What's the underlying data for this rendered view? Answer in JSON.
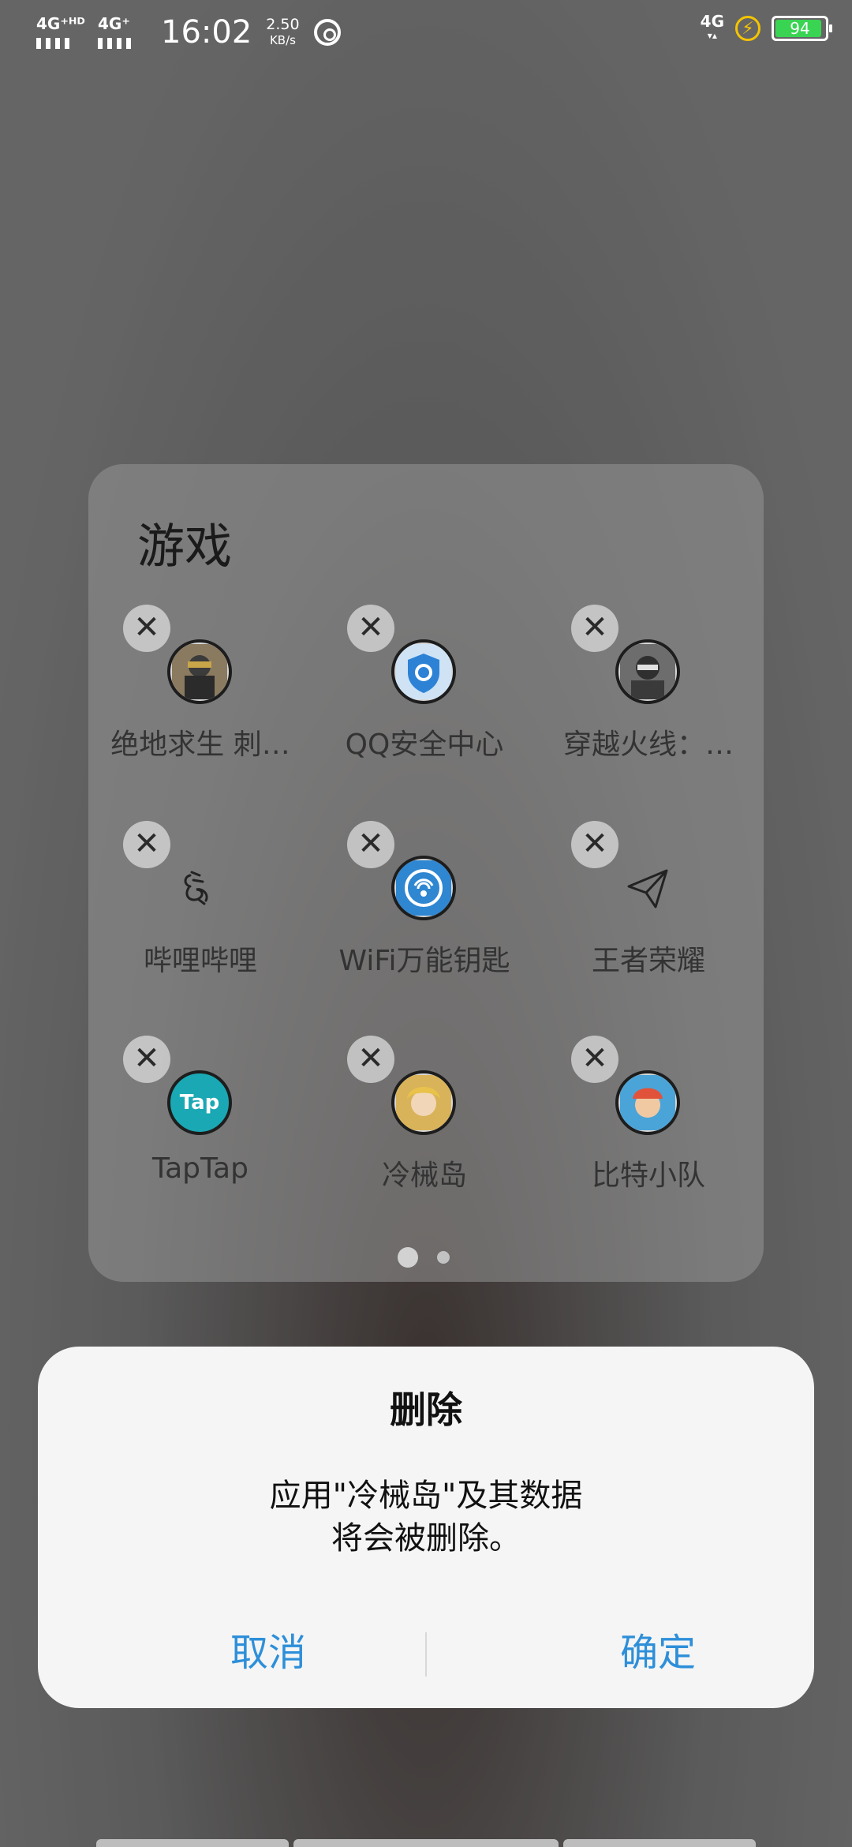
{
  "status_bar": {
    "signal1": "4G⁺ᴴᴰ",
    "signal2": "4G⁺",
    "time": "16:02",
    "speed_value": "2.50",
    "speed_unit": "KB/s",
    "right_network": "4G",
    "battery_level": "94",
    "battery_color": "#39d452"
  },
  "folder": {
    "title": "游戏",
    "apps": [
      {
        "label": "绝地求生 刺…",
        "icon": "pubg-icon"
      },
      {
        "label": "QQ安全中心",
        "icon": "qq-security-icon"
      },
      {
        "label": "穿越火线：…",
        "icon": "crossfire-icon"
      },
      {
        "label": "哔哩哔哩",
        "icon": "bilibili-icon"
      },
      {
        "label": "WiFi万能钥匙",
        "icon": "wifi-key-icon"
      },
      {
        "label": "王者荣耀",
        "icon": "paper-plane-icon"
      },
      {
        "label": "TapTap",
        "icon": "taptap-icon"
      },
      {
        "label": "冷械岛",
        "icon": "cold-island-icon"
      },
      {
        "label": "比特小队",
        "icon": "bit-squad-icon"
      }
    ],
    "close_glyph": "✕",
    "taptap_text": "Tap",
    "page_current": 1,
    "page_count": 2
  },
  "dialog": {
    "title": "删除",
    "message_line1": "应用\"冷械岛\"及其数据",
    "message_line2": "将会被删除。",
    "cancel_label": "取消",
    "confirm_label": "确定",
    "accent_color": "#2e8fd9"
  }
}
